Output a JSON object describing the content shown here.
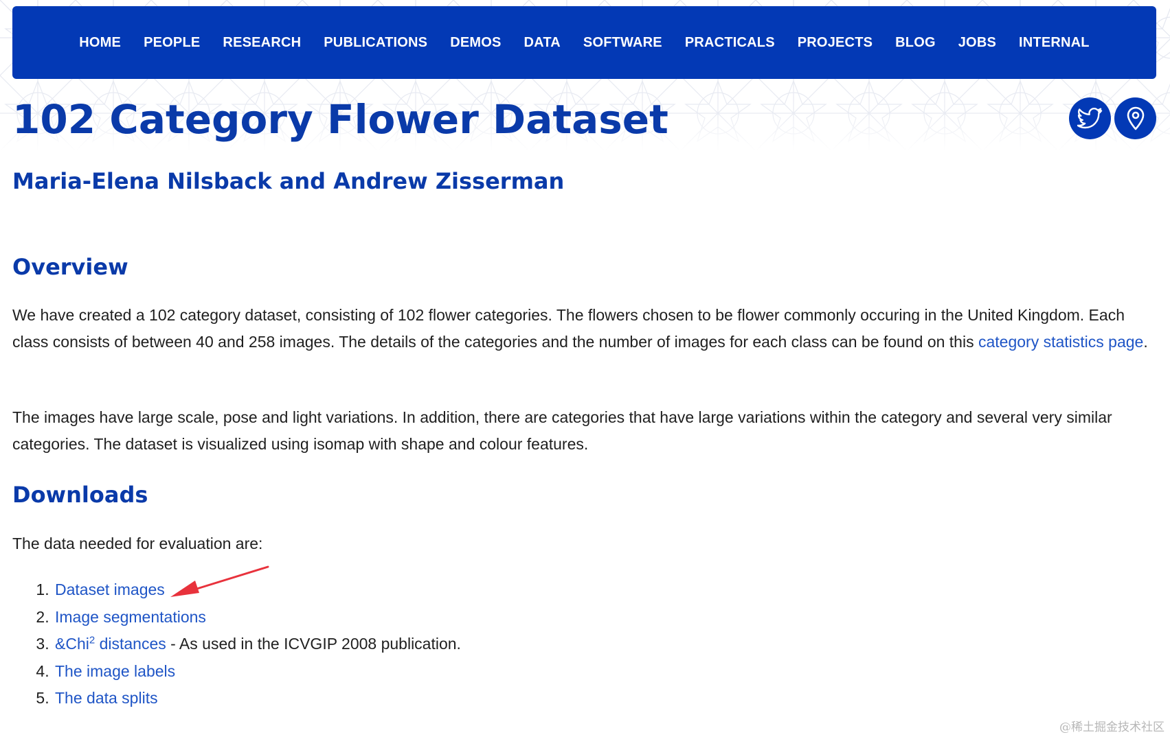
{
  "nav": {
    "items": [
      {
        "label": "HOME"
      },
      {
        "label": "PEOPLE"
      },
      {
        "label": "RESEARCH"
      },
      {
        "label": "PUBLICATIONS"
      },
      {
        "label": "DEMOS"
      },
      {
        "label": "DATA"
      },
      {
        "label": "SOFTWARE"
      },
      {
        "label": "PRACTICALS"
      },
      {
        "label": "PROJECTS"
      },
      {
        "label": "BLOG"
      },
      {
        "label": "JOBS"
      },
      {
        "label": "INTERNAL"
      }
    ]
  },
  "header": {
    "title": "102 Category Flower Dataset",
    "authors": "Maria-Elena Nilsback and Andrew Zisserman",
    "social": [
      "twitter-icon",
      "location-pin-icon"
    ]
  },
  "overview": {
    "heading": "Overview",
    "p1_text": "We have created a 102 category dataset, consisting of 102 flower categories. The flowers chosen to be flower commonly occuring in the United Kingdom. Each class consists of between 40 and 258 images. The details of the categories and the number of images for each class can be found on this ",
    "p1_link": "category statistics page",
    "p1_end": ".",
    "p2_text": "The images have large scale, pose and light variations. In addition, there are categories that have large variations within the category and several very similar categories. The dataset is visualized using isomap with shape and colour features."
  },
  "downloads": {
    "heading": "Downloads",
    "intro": "The data needed for evaluation are:",
    "items": [
      {
        "link": "Dataset images",
        "suffix": ""
      },
      {
        "link": "Image segmentations",
        "suffix": ""
      },
      {
        "link": "&Chi",
        "sup": "2",
        "link_rest": " distances",
        "suffix": " - As used in the ICVGIP 2008 publication."
      },
      {
        "link": "The image labels",
        "suffix": ""
      },
      {
        "link": "The data splits",
        "suffix": ""
      }
    ]
  },
  "annotation": {
    "arrow_color": "#e8323c"
  },
  "colors": {
    "nav_bg": "#0339b5",
    "heading": "#0a3aa9",
    "link": "#1f55c6"
  },
  "watermark": "@稀土掘金技术社区"
}
